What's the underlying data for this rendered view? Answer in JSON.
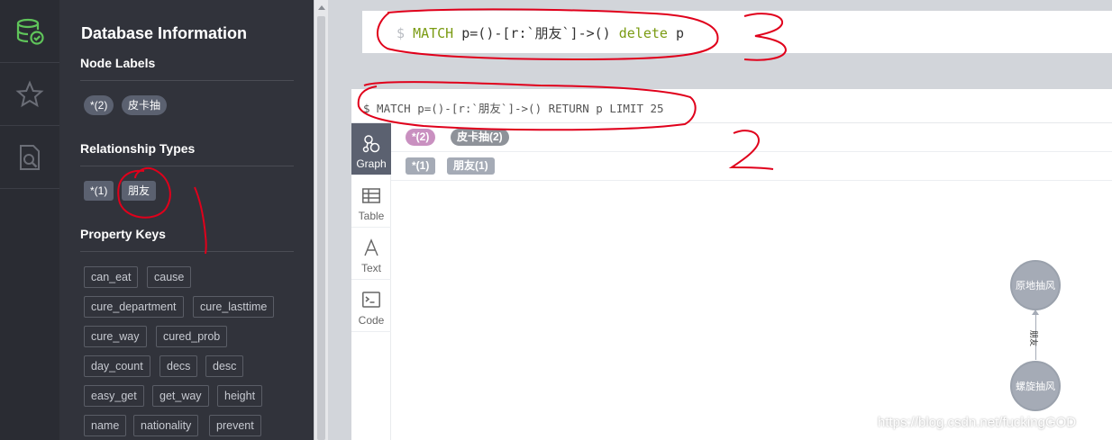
{
  "drawer": {
    "title": "Database Information",
    "node_labels_title": "Node Labels",
    "node_labels": [
      "*(2)",
      "皮卡抽"
    ],
    "relationship_types_title": "Relationship Types",
    "relationship_types": [
      "*(1)",
      "朋友"
    ],
    "property_keys_title": "Property Keys",
    "property_keys": [
      "can_eat",
      "cause",
      "cure_department",
      "cure_lasttime",
      "cure_way",
      "cured_prob",
      "day_count",
      "decs",
      "desc",
      "easy_get",
      "get_way",
      "height",
      "name",
      "nationality",
      "prevent"
    ]
  },
  "rail": {
    "items": [
      "database-icon",
      "star-icon",
      "search-document-icon"
    ]
  },
  "editor": {
    "dollar": "$",
    "kw1": "MATCH",
    "mid": " p=()-[r:`朋友`]->() ",
    "kw2": "delete",
    "tail": " p"
  },
  "frame": {
    "command": "$ MATCH p=()-[r:`朋友`]->() RETURN p LIMIT 25",
    "tabs": [
      "Graph",
      "Table",
      "Text",
      "Code"
    ],
    "legend_nodes": [
      "*(2)",
      "皮卡抽(2)"
    ],
    "legend_rels": [
      "*(1)",
      "朋友(1)"
    ],
    "nodes": [
      "原地抽风",
      "螺旋抽风"
    ],
    "relationship_label": "朋友"
  },
  "annotations": [
    "1",
    "2",
    "3"
  ],
  "watermark": "https://blog.csdn.net/fuckingGOD",
  "colors": {
    "rail_bg": "#2a2c33",
    "drawer_bg": "#31333b",
    "accent_green": "#7a9b12",
    "node_pink": "#c990c0",
    "node_grey": "#a5abb6",
    "annotation_red": "#e0001b"
  }
}
